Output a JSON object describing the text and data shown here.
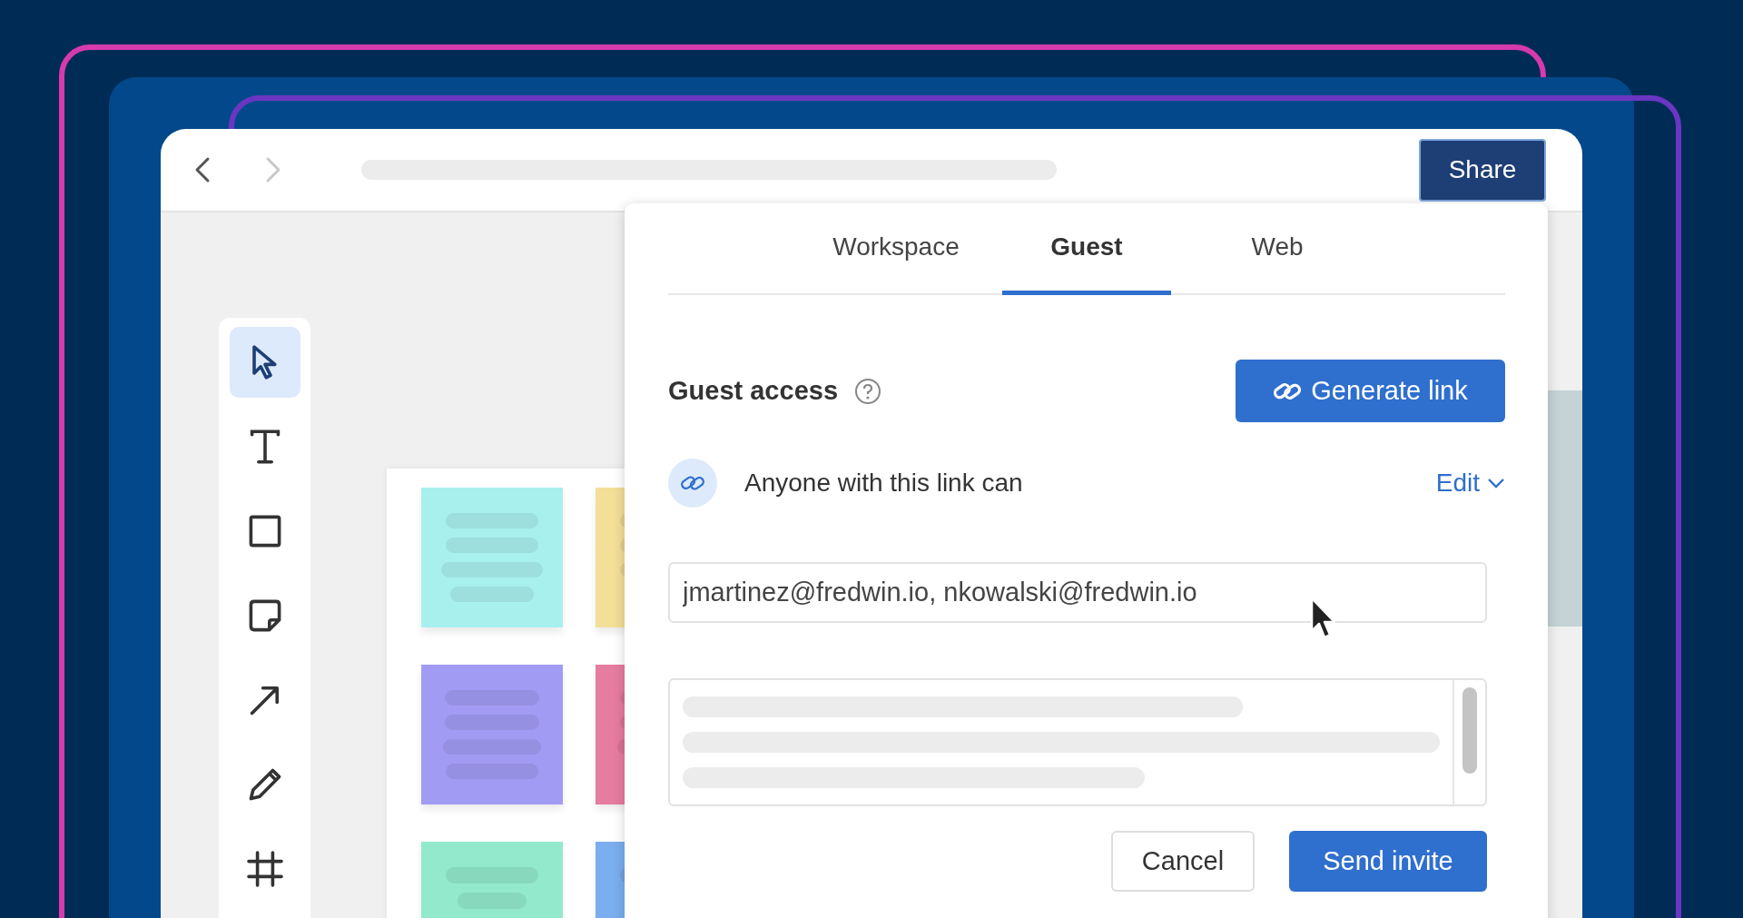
{
  "window": {
    "nav_buttons": [
      {
        "kind": "back",
        "disabled": false
      },
      {
        "kind": "forward",
        "disabled": true
      }
    ],
    "share_button": "Share"
  },
  "tools": [
    {
      "kind": "select",
      "selected": true
    },
    {
      "kind": "text",
      "selected": false
    },
    {
      "kind": "rectangle",
      "selected": false
    },
    {
      "kind": "sticky",
      "selected": false
    },
    {
      "kind": "arrow",
      "selected": false
    },
    {
      "kind": "pencil",
      "selected": false
    },
    {
      "kind": "frame",
      "selected": false
    }
  ],
  "sticky_notes": [
    {
      "color": "#a8f0ee"
    },
    {
      "color": "#f3df97"
    },
    {
      "color": "#a29bf4"
    },
    {
      "color": "#e67c9f"
    },
    {
      "color": "#92e9cb"
    },
    {
      "color": "#7aaeee"
    }
  ],
  "dialog": {
    "tabs": [
      {
        "label": "Workspace",
        "selected": false
      },
      {
        "label": "Guest",
        "selected": true
      },
      {
        "label": "Web",
        "selected": false
      }
    ],
    "title": "Guest access",
    "generate_button": "Generate link",
    "link_permission": {
      "label": "Anyone with this link can",
      "value": "Edit"
    },
    "emails": {
      "value": "jmartinez@fredwin.io, nkowalski@fredwin.io"
    },
    "cancel_button": "Cancel",
    "send_button": "Send invite"
  }
}
